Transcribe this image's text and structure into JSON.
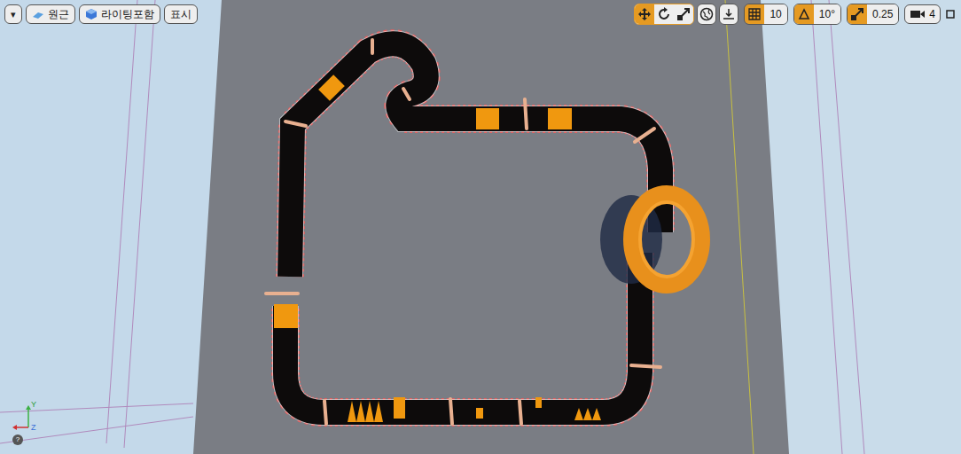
{
  "viewport_toolbar": {
    "menu_button": "▾",
    "left_buttons": [
      {
        "label": "원근",
        "kind": "perspective"
      },
      {
        "label": "라이팅포함",
        "kind": "lit"
      },
      {
        "label": "표시",
        "kind": "show"
      }
    ],
    "transform_tools": [
      {
        "kind": "translate",
        "selected": true
      },
      {
        "kind": "rotate",
        "selected": false
      },
      {
        "kind": "scale",
        "selected": false
      }
    ],
    "world_space": {
      "enabled": false
    },
    "surface_snap": {
      "enabled": false
    },
    "snaps": [
      {
        "kind": "grid",
        "value": "10",
        "enabled": true
      },
      {
        "kind": "rotation",
        "value": "10°",
        "enabled": true
      },
      {
        "kind": "scale",
        "value": "0.25",
        "enabled": true
      }
    ],
    "camera_speed": {
      "value": "4"
    }
  },
  "axis_gizmo": {
    "labels": [
      "Y",
      "Z"
    ],
    "help": "?"
  }
}
